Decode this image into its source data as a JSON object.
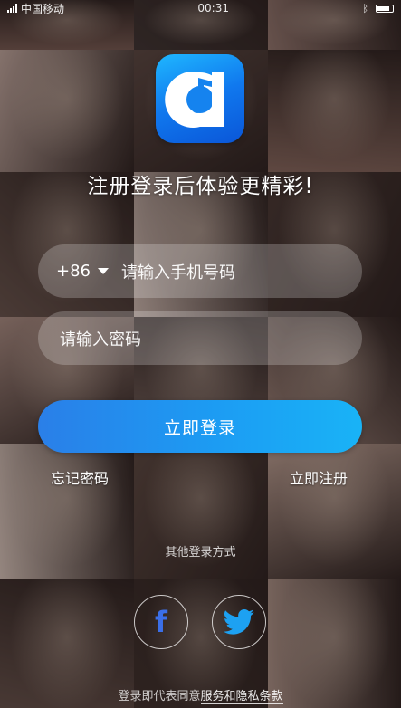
{
  "status_bar": {
    "carrier": "中国移动",
    "time": "00:31",
    "battery_percent": 85
  },
  "logo": {
    "icon": "music-note-app-logo"
  },
  "headline": "注册登录后体验更精彩!",
  "phone": {
    "country_code": "+86",
    "placeholder": "请输入手机号码"
  },
  "password": {
    "placeholder": "请输入密码"
  },
  "login_button": "立即登录",
  "forgot_password": "忘记密码",
  "register": "立即注册",
  "other_login_label": "其他登录方式",
  "social": [
    {
      "name": "facebook",
      "icon": "facebook-icon",
      "glyph": "f"
    },
    {
      "name": "twitter",
      "icon": "twitter-icon"
    }
  ],
  "terms": {
    "prefix": "登录即代表同意",
    "link": "服务和隐私条款"
  },
  "colors": {
    "accent": "#1c9cf3",
    "logo_blue": "#1078ee",
    "twitter_blue": "#1da1f2",
    "facebook_blue": "#3b6fe8"
  },
  "background_tiles": [
    "#7a5d54",
    "#3f3533",
    "#9a7d74",
    "#c9b0a6",
    "#5d4a44",
    "#8c6c61",
    "#6b574f",
    "#d8c4ba",
    "#4a3a35",
    "#b2958a",
    "#7d6a63",
    "#a88d82",
    "#e2cfc4",
    "#5e4b43",
    "#c8ab9d",
    "#6f5a52",
    "#40322d",
    "#b49a8e"
  ]
}
